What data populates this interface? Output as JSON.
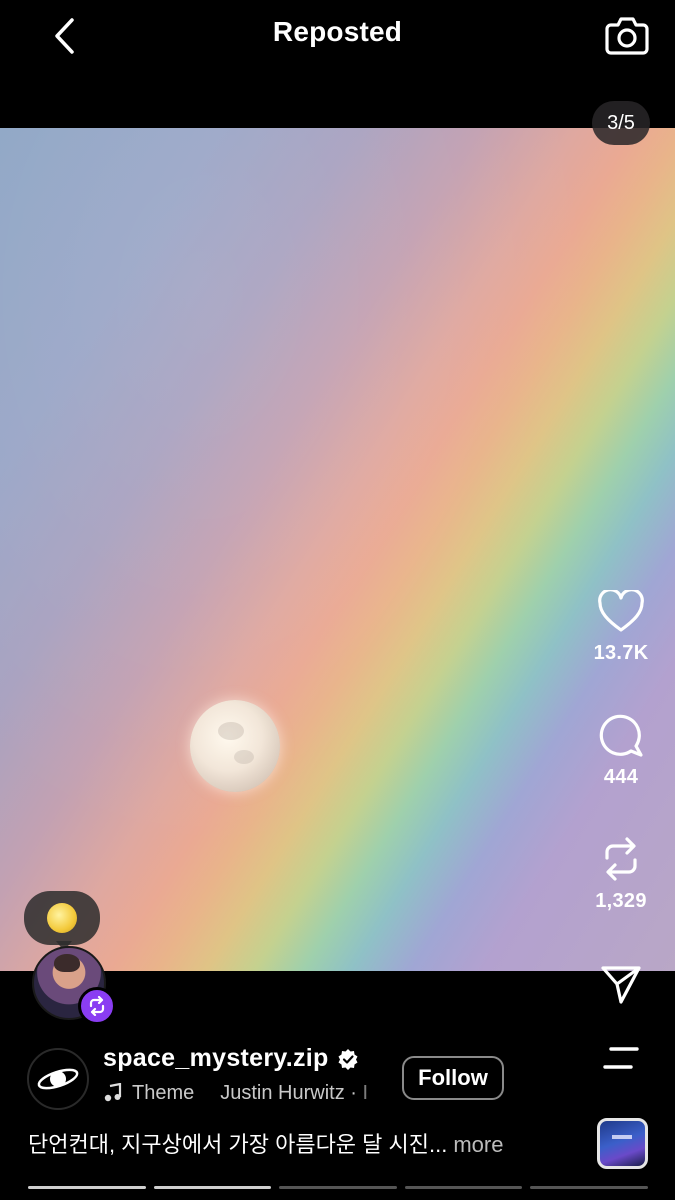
{
  "header": {
    "title": "Reposted"
  },
  "media": {
    "page_indicator": "3/5"
  },
  "actions": {
    "likes": "13.7K",
    "comments": "444",
    "reposts": "1,329"
  },
  "post": {
    "username": "space_mystery.zip",
    "verified": true,
    "music_theme": "Theme",
    "music_artist": "Justin Hurwitz · I",
    "follow_label": "Follow",
    "caption": "단언컨대, 지구상에서 가장 아름다운 달 시진...",
    "more_label": "more"
  },
  "carousel": {
    "total": 5,
    "current": 3
  },
  "icons": {
    "back": "chevron-left-icon",
    "camera": "camera-icon",
    "like": "heart-icon",
    "comment": "comment-icon",
    "repost": "repost-icon",
    "share": "send-icon",
    "menu": "menu-icon",
    "music": "music-note-icon",
    "verified": "verified-badge-icon"
  },
  "colors": {
    "repost_badge": "#8a3df2",
    "background": "#000000"
  }
}
